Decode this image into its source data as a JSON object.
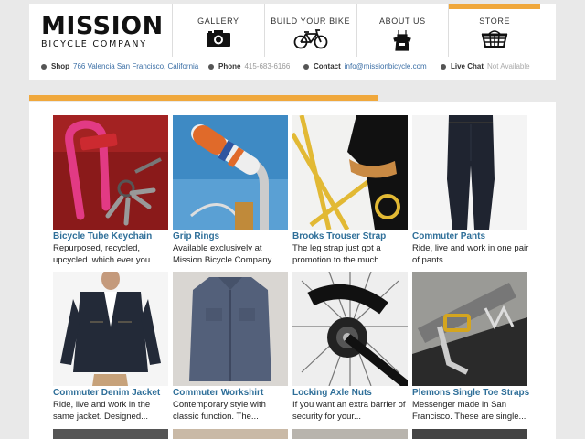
{
  "logo": {
    "main": "MISSION",
    "sub": "BICYCLE COMPANY"
  },
  "nav": [
    {
      "label": "GALLERY",
      "icon": "camera-icon"
    },
    {
      "label": "BUILD YOUR BIKE",
      "icon": "bicycle-icon"
    },
    {
      "label": "ABOUT US",
      "icon": "apron-icon"
    },
    {
      "label": "STORE",
      "icon": "basket-icon",
      "active": true
    }
  ],
  "info": {
    "shop_label": "Shop",
    "shop_value": "766 Valencia San Francisco, California",
    "phone_label": "Phone",
    "phone_value": "415-683-6166",
    "contact_label": "Contact",
    "contact_value": "info@missionbicycle.com",
    "chat_label": "Live Chat",
    "chat_value": "Not Available"
  },
  "colors": {
    "accent": "#f0a83c",
    "link": "#2f6f99"
  },
  "products": [
    {
      "title": "Bicycle Tube Keychain",
      "desc": "Repurposed, recycled, upcycled..which ever you..."
    },
    {
      "title": "Grip Rings",
      "desc": "Available exclusively at Mission Bicycle Company..."
    },
    {
      "title": "Brooks Trouser Strap",
      "desc": "The leg strap just got a promotion to the much..."
    },
    {
      "title": "Commuter Pants",
      "desc": "Ride, live and work in one pair of pants..."
    },
    {
      "title": "Commuter Denim Jacket",
      "desc": "Ride, live and work in the same jacket. Designed..."
    },
    {
      "title": "Commuter Workshirt",
      "desc": "Contemporary style with classic function. The..."
    },
    {
      "title": "Locking Axle Nuts",
      "desc": "If you want an extra barrier of security for your..."
    },
    {
      "title": "Plemons Single Toe Straps",
      "desc": "Messenger made in San Francisco. These are single..."
    }
  ]
}
